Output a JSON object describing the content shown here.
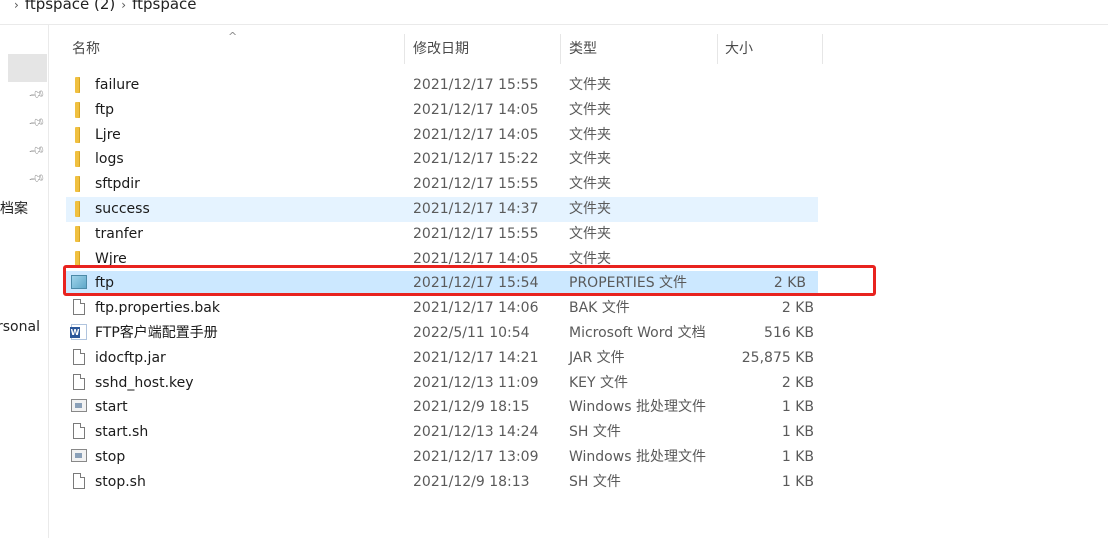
{
  "breadcrumb": [
    "ftpspace (2)",
    "ftpspace"
  ],
  "nav": {
    "labels": [
      "档案",
      "rsonal"
    ]
  },
  "columns": {
    "name": "名称",
    "date": "修改日期",
    "type": "类型",
    "size": "大小"
  },
  "files": [
    {
      "name": "failure",
      "date": "2021/12/17 15:55",
      "type": "文件夹",
      "size": "",
      "icon": "folder-icon"
    },
    {
      "name": "ftp",
      "date": "2021/12/17 14:05",
      "type": "文件夹",
      "size": "",
      "icon": "folder-icon"
    },
    {
      "name": "Ljre",
      "date": "2021/12/17 14:05",
      "type": "文件夹",
      "size": "",
      "icon": "folder-icon"
    },
    {
      "name": "logs",
      "date": "2021/12/17 15:22",
      "type": "文件夹",
      "size": "",
      "icon": "folder-icon"
    },
    {
      "name": "sftpdir",
      "date": "2021/12/17 15:55",
      "type": "文件夹",
      "size": "",
      "icon": "folder-icon"
    },
    {
      "name": "success",
      "date": "2021/12/17 14:37",
      "type": "文件夹",
      "size": "",
      "icon": "folder-icon",
      "state": "hover"
    },
    {
      "name": "tranfer",
      "date": "2021/12/17 15:55",
      "type": "文件夹",
      "size": "",
      "icon": "folder-icon"
    },
    {
      "name": "Wjre",
      "date": "2021/12/17 14:05",
      "type": "文件夹",
      "size": "",
      "icon": "folder-icon"
    },
    {
      "name": "ftp",
      "date": "2021/12/17 15:54",
      "type": "PROPERTIES 文件",
      "size": "2 KB",
      "icon": "properties-file-icon",
      "state": "selected"
    },
    {
      "name": "ftp.properties.bak",
      "date": "2021/12/17 14:06",
      "type": "BAK 文件",
      "size": "2 KB",
      "icon": "file-icon"
    },
    {
      "name": "FTP客户端配置手册",
      "date": "2022/5/11 10:54",
      "type": "Microsoft Word 文档",
      "size": "516 KB",
      "icon": "word-doc-icon"
    },
    {
      "name": "idocftp.jar",
      "date": "2021/12/17 14:21",
      "type": "JAR 文件",
      "size": "25,875 KB",
      "icon": "file-icon"
    },
    {
      "name": "sshd_host.key",
      "date": "2021/12/13 11:09",
      "type": "KEY 文件",
      "size": "2 KB",
      "icon": "file-icon"
    },
    {
      "name": "start",
      "date": "2021/12/9 18:15",
      "type": "Windows 批处理文件",
      "size": "1 KB",
      "icon": "batch-file-icon"
    },
    {
      "name": "start.sh",
      "date": "2021/12/13 14:24",
      "type": "SH 文件",
      "size": "1 KB",
      "icon": "file-icon"
    },
    {
      "name": "stop",
      "date": "2021/12/17 13:09",
      "type": "Windows 批处理文件",
      "size": "1 KB",
      "icon": "batch-file-icon"
    },
    {
      "name": "stop.sh",
      "date": "2021/12/9 18:13",
      "type": "SH 文件",
      "size": "1 KB",
      "icon": "file-icon"
    }
  ],
  "colors": {
    "selected_row": "#cce8ff",
    "hover_row": "#e5f3ff",
    "annotation_box": "#e8231f"
  }
}
